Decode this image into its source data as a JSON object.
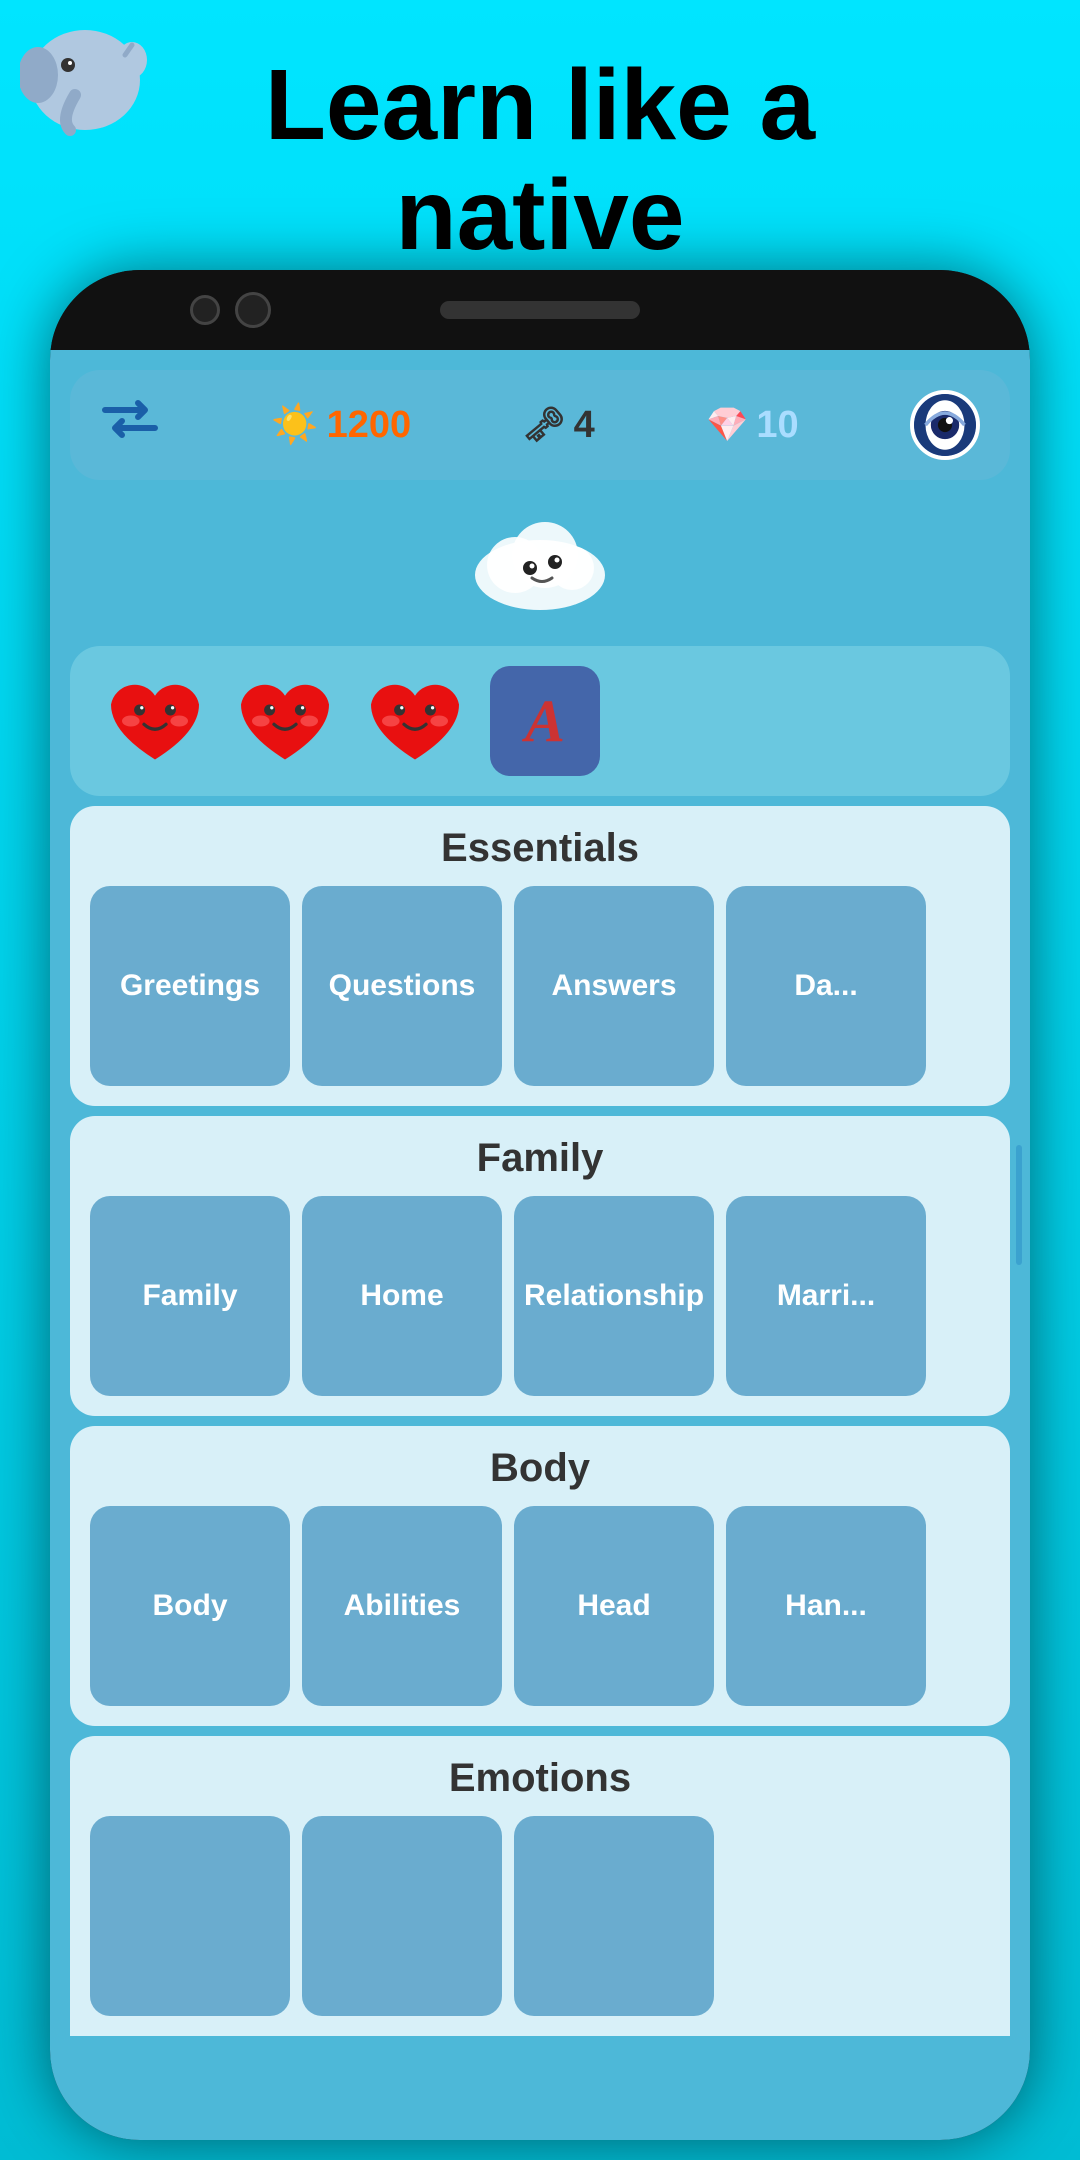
{
  "header": {
    "title_line1": "Learn like a",
    "title_line2": "native"
  },
  "stats": {
    "xp": "1200",
    "keys": "4",
    "gems": "10"
  },
  "sections": [
    {
      "id": "essentials",
      "title": "Essentials",
      "items": [
        "Greetings",
        "Questions",
        "Answers",
        "Da..."
      ]
    },
    {
      "id": "family",
      "title": "Family",
      "items": [
        "Family",
        "Home",
        "Relationship",
        "Marri..."
      ]
    },
    {
      "id": "body",
      "title": "Body",
      "items": [
        "Body",
        "Abilities",
        "Head",
        "Han..."
      ]
    },
    {
      "id": "emotions",
      "title": "Emotions",
      "items": [
        "",
        "",
        ""
      ]
    }
  ],
  "icons": {
    "sun": "☀️",
    "key": "🗝",
    "gem": "💎",
    "heart": "❤️",
    "cloud": "☁️"
  },
  "lives": 3
}
